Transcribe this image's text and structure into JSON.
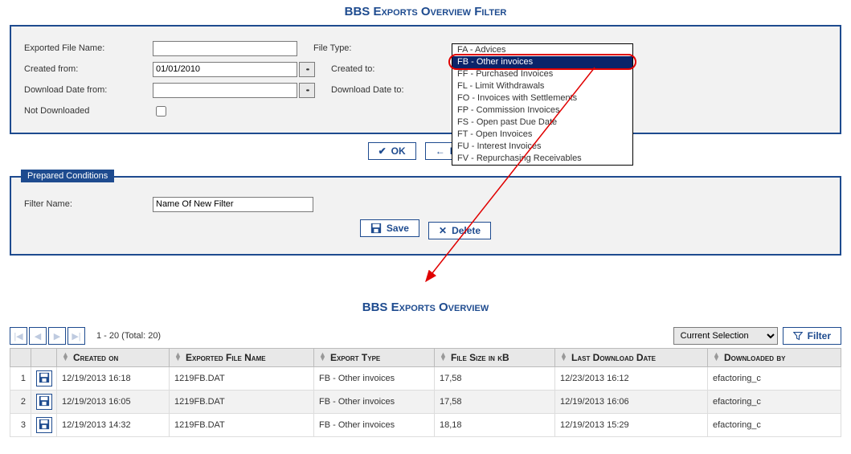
{
  "filter_section": {
    "title": "BBS Exports Overview Filter",
    "rows": {
      "exported_file_name_label": "Exported File Name:",
      "exported_file_name_value": "",
      "file_type_label": "File Type:",
      "created_from_label": "Created from:",
      "created_from_value": "01/01/2010",
      "created_to_label": "Created to:",
      "download_from_label": "Download Date from:",
      "download_from_value": "",
      "download_to_label": "Download Date to:",
      "not_downloaded_label": "Not Downloaded"
    },
    "dropdown": {
      "items": [
        "FA - Advices",
        "FB - Other invoices",
        "FF - Purchased Invoices",
        "FL - Limit Withdrawals",
        "FO - Invoices with Settlements",
        "FP - Commission Invoices",
        "FS - Open past Due Date",
        "FT - Open Invoices",
        "FU - Interest Invoices",
        "FV - Repurchasing Receivables"
      ],
      "selected_index": 1
    },
    "buttons": {
      "ok": "OK",
      "back": "Back"
    }
  },
  "conditions": {
    "legend": "Prepared Conditions",
    "filter_name_label": "Filter Name:",
    "filter_name_value": "Name Of New Filter",
    "save": "Save",
    "delete": "Delete"
  },
  "overview": {
    "title": "BBS Exports Overview",
    "range": "1 - 20 (Total: 20)",
    "selection": "Current Selection",
    "filter_btn": "Filter",
    "columns": {
      "created_on": "Created on",
      "exported_file_name": "Exported File Name",
      "export_type": "Export Type",
      "file_size": "File Size in kB",
      "last_download": "Last Download Date",
      "downloaded_by": "Downloaded by"
    },
    "rows": [
      {
        "n": "1",
        "created": "12/19/2013 16:18",
        "file": "1219FB.DAT",
        "type": "FB - Other invoices",
        "size": "17,58",
        "dl": "12/23/2013 16:12",
        "by": "efactoring_c"
      },
      {
        "n": "2",
        "created": "12/19/2013 16:05",
        "file": "1219FB.DAT",
        "type": "FB - Other invoices",
        "size": "17,58",
        "dl": "12/19/2013 16:06",
        "by": "efactoring_c"
      },
      {
        "n": "3",
        "created": "12/19/2013 14:32",
        "file": "1219FB.DAT",
        "type": "FB - Other invoices",
        "size": "18,18",
        "dl": "12/19/2013 15:29",
        "by": "efactoring_c"
      }
    ]
  }
}
